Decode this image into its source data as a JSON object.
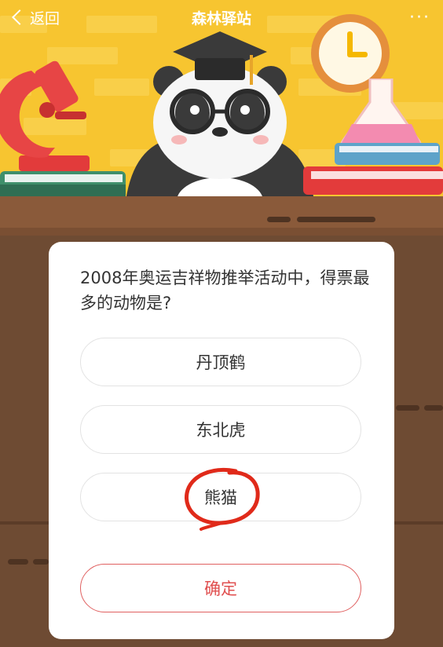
{
  "header": {
    "back_label": "返回",
    "title": "森林驿站",
    "more_label": "···"
  },
  "quiz": {
    "question": "2008年奥运吉祥物推举活动中，得票最多的动物是?",
    "options": [
      {
        "label": "丹顶鹤"
      },
      {
        "label": "东北虎"
      },
      {
        "label": "熊猫"
      }
    ],
    "confirm_label": "确定"
  },
  "colors": {
    "wall": "#f7c530",
    "desk": "#6e4b33",
    "accent_red": "#e05050",
    "annotation": "#e02a1a"
  },
  "icons": [
    "back-chevron-icon",
    "more-icon",
    "microscope-icon",
    "panda-icon",
    "clock-icon",
    "flask-icon",
    "books-icon"
  ]
}
